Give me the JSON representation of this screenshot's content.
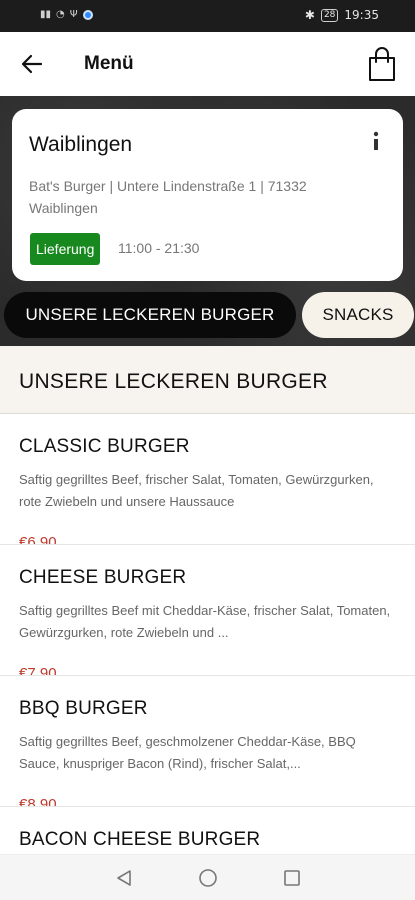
{
  "status_bar": {
    "time": "19:35",
    "battery": "28"
  },
  "header": {
    "title": "Menü",
    "back_icon": "arrow-left-icon",
    "cart_icon": "shopping-bag-icon"
  },
  "store": {
    "name": "Waiblingen",
    "address": "Bat's Burger | Untere Lindenstraße 1 | 71332 Waiblingen",
    "delivery_label": "Lieferung",
    "hours": "11:00 - 21:30",
    "info_icon": "info-icon"
  },
  "tabs": [
    {
      "label": "UNSERE LECKEREN BURGER",
      "active": true
    },
    {
      "label": "SNACKS",
      "active": false
    }
  ],
  "section": {
    "title": "UNSERE LECKEREN BURGER"
  },
  "menu_items": [
    {
      "name": "CLASSIC BURGER",
      "description": "Saftig gegrilltes Beef, frischer Salat, Tomaten, Gewürzgurken, rote Zwiebeln und unsere Haussauce",
      "price": "€6,90"
    },
    {
      "name": "CHEESE BURGER",
      "description": "Saftig gegrilltes Beef mit Cheddar-Käse, frischer Salat, Tomaten, Gewürzgurken, rote Zwiebeln und ...",
      "price": "€7,90"
    },
    {
      "name": "BBQ BURGER",
      "description": "Saftig gegrilltes Beef, geschmolzener Cheddar-Käse, BBQ Sauce, knuspriger Bacon (Rind), frischer Salat,...",
      "price": "€8,90"
    },
    {
      "name": "BACON CHEESE BURGER",
      "description": "",
      "price": ""
    }
  ],
  "colors": {
    "accent_green": "#18891f",
    "price_red": "#c0392b"
  }
}
